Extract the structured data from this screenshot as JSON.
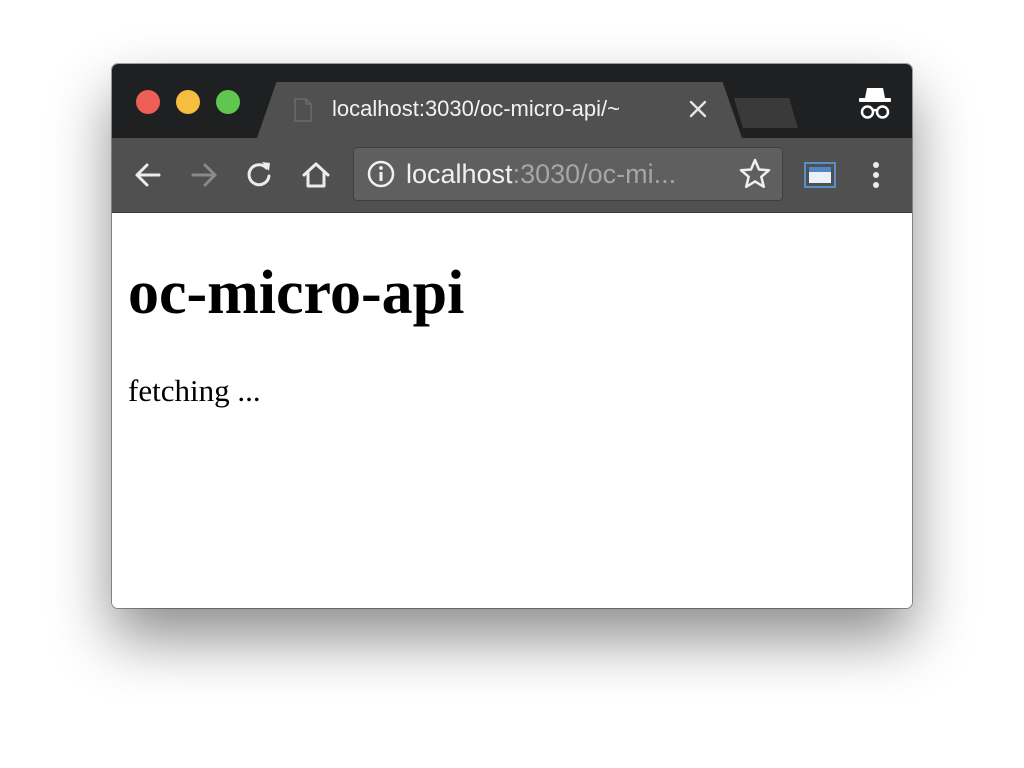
{
  "browser": {
    "tab": {
      "title": "localhost:3030/oc-micro-api/~",
      "close_icon": "close-icon",
      "page_icon": "page-icon"
    },
    "address_bar": {
      "host": "localhost",
      "rest": ":3030/oc-mi..."
    },
    "icons": {
      "back": "back-arrow-icon",
      "forward": "forward-arrow-icon",
      "reload": "reload-icon",
      "home": "home-icon",
      "info": "info-icon",
      "bookmark": "star-icon",
      "cast": "cast-icon",
      "menu": "menu-icon",
      "incognito": "incognito-icon"
    },
    "colors": {
      "titlebar": "#1f2022",
      "toolbar": "#505050",
      "close": "#ee5f57",
      "minimize": "#f5be3e",
      "maximize": "#5fc74f"
    }
  },
  "page": {
    "heading": "oc-micro-api",
    "status": "fetching ..."
  }
}
